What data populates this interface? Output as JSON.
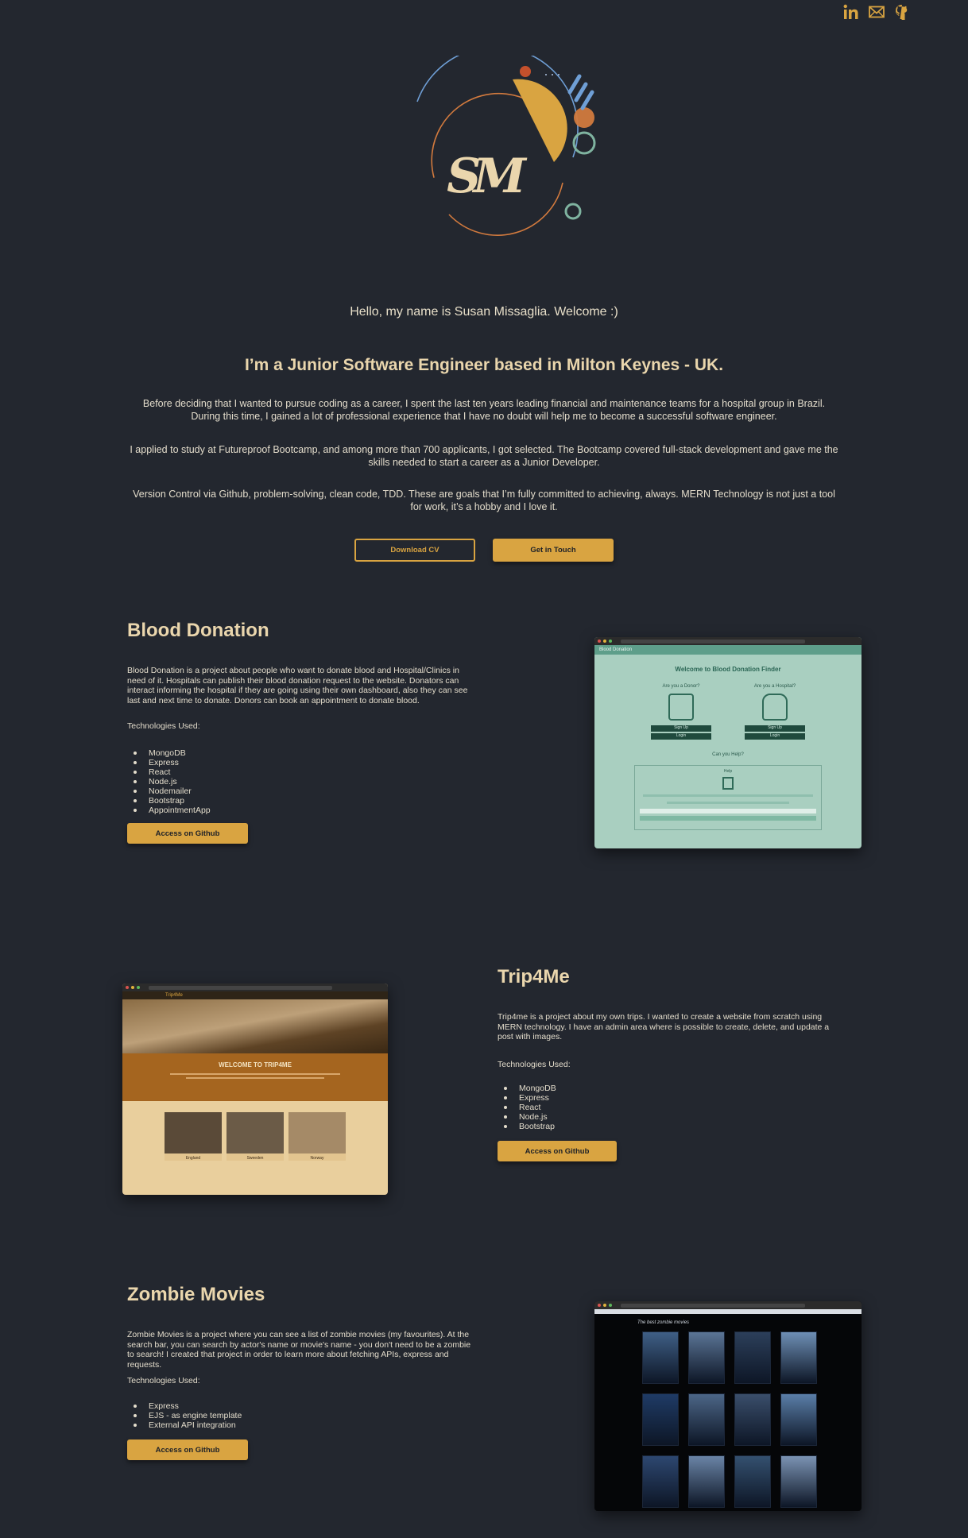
{
  "social": {
    "linkedin_icon": "linkedin-icon",
    "email_icon": "mail-icon",
    "github_icon": "github-icon",
    "accent": "#d9a441"
  },
  "logo": {
    "monogram": "SM"
  },
  "intro": {
    "hello": "Hello, my name is Susan Missaglia. Welcome :)",
    "headline": "I’m a Junior Software Engineer based in Milton Keynes - UK.",
    "paragraphs": [
      "Before deciding that I wanted to pursue coding as a career, I spent the last ten years leading financial and maintenance teams for a hospital group in Brazil. During this time, I gained a lot of professional experience that I have no doubt will help me to become a successful software engineer.",
      "I applied to study at Futureproof Bootcamp, and among more than 700 applicants, I got selected. The Bootcamp covered full-stack development and gave me the skills needed to start a career as a Junior Developer.",
      "Version Control via Github, problem-solving, clean code, TDD. These are goals that I’m fully committed to achieving, always. MERN Technology is not just a tool for work, it’s a hobby and I love it."
    ],
    "download_cv": "Download CV",
    "get_in_touch": "Get in Touch"
  },
  "projects": [
    {
      "title": "Blood Donation",
      "description": "Blood Donation is a project about people who want to donate blood and Hospital/Clinics in need of it. Hospitals can publish their blood donation request to the website. Donators can interact informing the hospital if they are going using their own dashboard, also they can see last and next time to donate. Donors can book an appointment to donate blood.",
      "tech_label": "Technologies Used:",
      "tech": [
        "MongoDB",
        "Express",
        "React",
        "Node.js",
        "Nodemailer",
        "Bootstrap",
        "AppointmentApp"
      ],
      "button": "Access on Github",
      "screenshot": {
        "brand": "Blood Donation",
        "heading": "Welcome to Blood Donation Finder",
        "donor": "Are you a Donor?",
        "hospital": "Are you a Hospital?",
        "signup": "Sign Up",
        "login": "Login",
        "help": "Can you Help?",
        "help_box": "Help"
      }
    },
    {
      "title": "Trip4Me",
      "description": "Trip4me is a project about my own trips. I wanted to create a website from scratch using MERN technology. I have an admin area where is possible to create, delete, and update a post with images.",
      "tech_label": "Technologies Used:",
      "tech": [
        "MongoDB",
        "Express",
        "React",
        "Node.js",
        "Bootstrap"
      ],
      "button": "Access on Github",
      "screenshot": {
        "brand": "Trip4Me",
        "banner": "WELCOME TO TRIP4ME",
        "cards": [
          "England",
          "Sweeden",
          "Norway"
        ]
      }
    },
    {
      "title": "Zombie Movies",
      "description": "Zombie Movies is a project where you can see a list of zombie movies (my favourites). At the search bar, you can search by actor's name or movie's name - you don't need to be a zombie to search! I created that project in order to learn more about fetching APIs, express and requests.",
      "tech_label": "Technologies Used:",
      "tech": [
        "Express",
        "EJS - as engine template",
        "External API integration"
      ],
      "button": "Access on Github",
      "screenshot": {
        "heading": "The best zombie movies"
      }
    }
  ]
}
